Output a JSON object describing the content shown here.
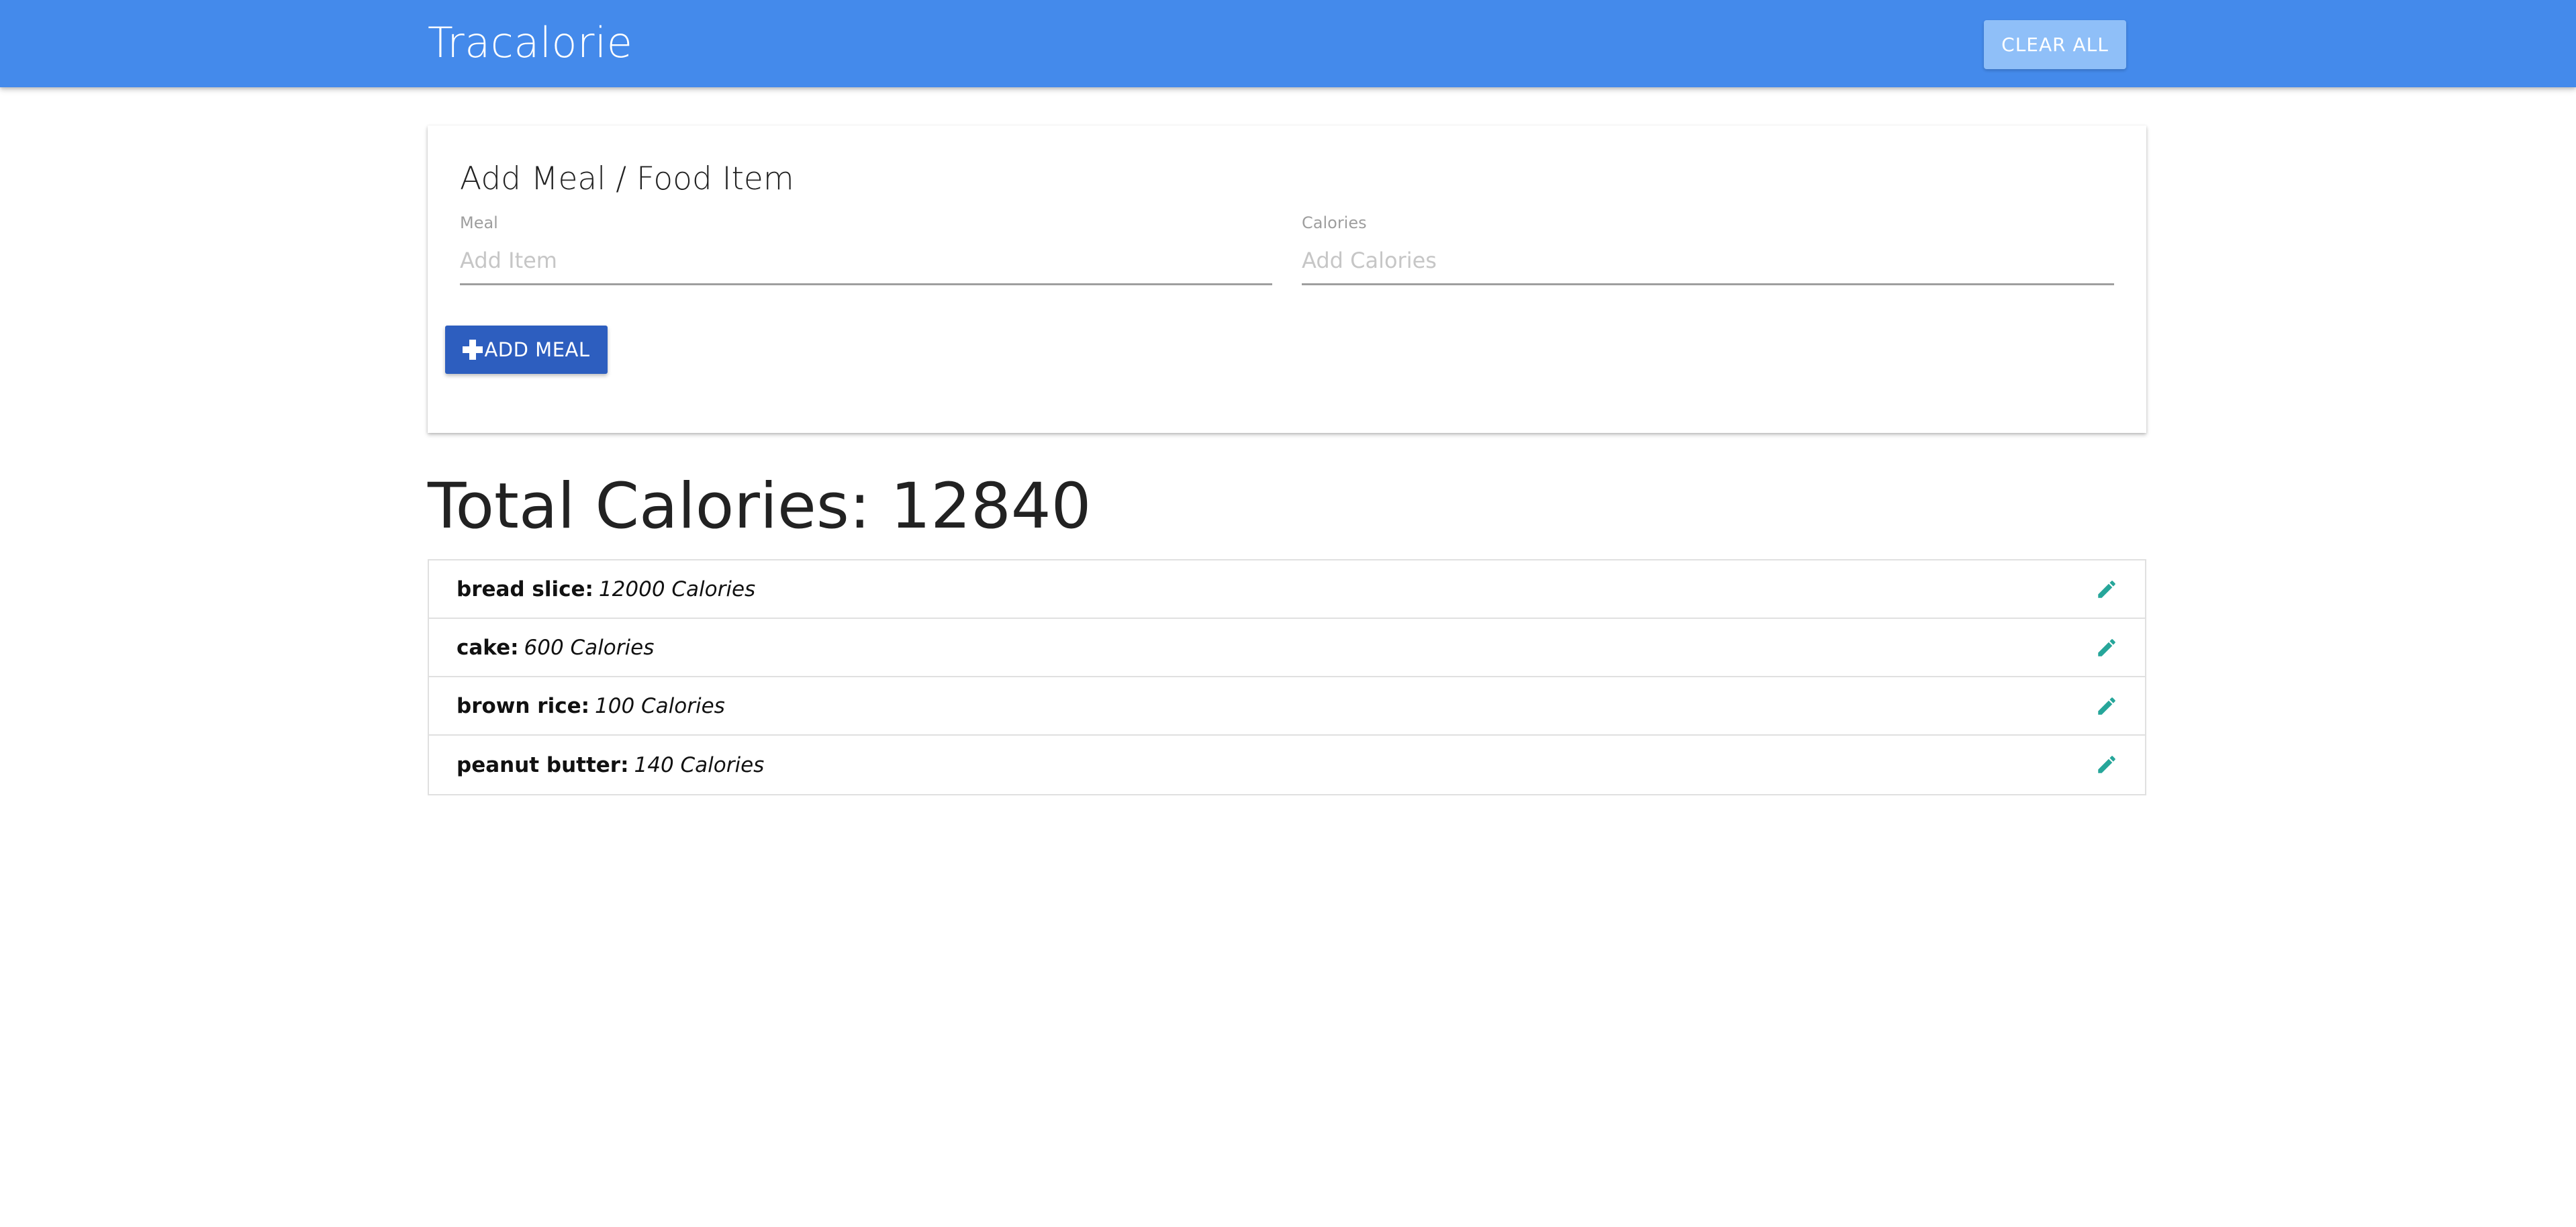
{
  "navbar": {
    "brand": "Tracalorie",
    "clear_all_label": "CLEAR ALL",
    "color": "#448aeb"
  },
  "form": {
    "title": "Add Meal / Food Item",
    "meal_label": "Meal",
    "meal_value": "",
    "meal_placeholder": "Add Item",
    "calories_label": "Calories",
    "calories_value": "",
    "calories_placeholder": "Add Calories",
    "add_button_label": "ADD MEAL",
    "add_button_icon": "plus-icon",
    "add_button_color": "#2d5ebf"
  },
  "total": {
    "text": "Total Calories: 12840"
  },
  "items": [
    {
      "name": "bread slice:",
      "calories": "12000 Calories",
      "icon": "pencil-icon"
    },
    {
      "name": "cake:",
      "calories": "600 Calories",
      "icon": "pencil-icon"
    },
    {
      "name": "brown rice:",
      "calories": "100 Calories",
      "icon": "pencil-icon"
    },
    {
      "name": "peanut butter:",
      "calories": "140 Calories",
      "icon": "pencil-icon"
    }
  ],
  "edit_icon_color": "#26a69a"
}
